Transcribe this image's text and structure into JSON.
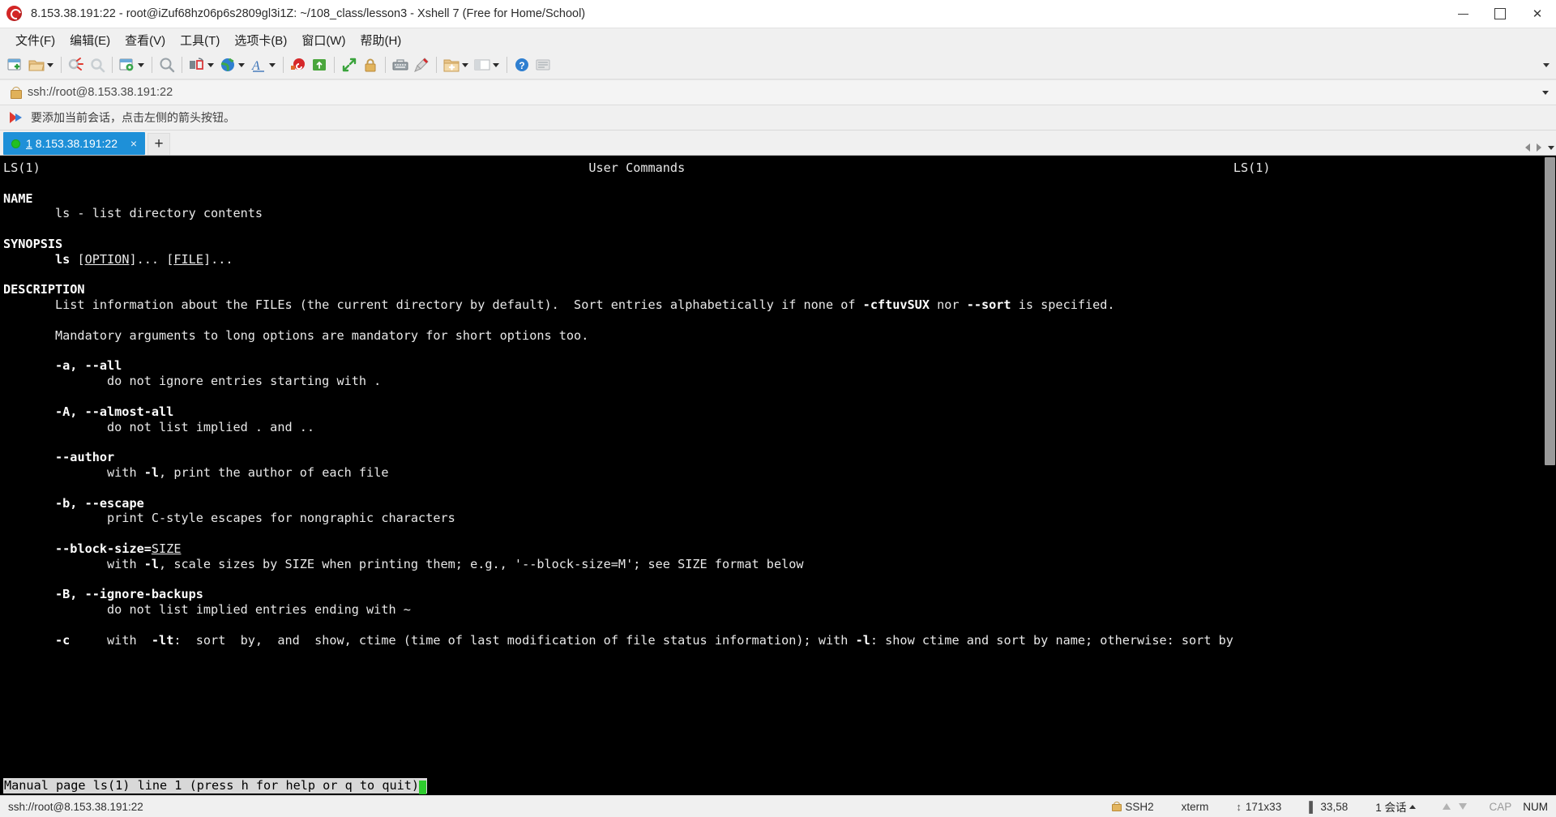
{
  "window": {
    "title": "8.153.38.191:22 - root@iZuf68hz06p6s2809gl3i1Z: ~/108_class/lesson3 - Xshell 7 (Free for Home/School)",
    "app_icon": "xshell-logo-icon",
    "minimize_label": "—",
    "maximize_label": "❐",
    "close_label": "✕"
  },
  "menu": {
    "items": [
      {
        "label": "文件(F)",
        "name": "menu-file"
      },
      {
        "label": "编辑(E)",
        "name": "menu-edit"
      },
      {
        "label": "查看(V)",
        "name": "menu-view"
      },
      {
        "label": "工具(T)",
        "name": "menu-tools"
      },
      {
        "label": "选项卡(B)",
        "name": "menu-tabs"
      },
      {
        "label": "窗口(W)",
        "name": "menu-window"
      },
      {
        "label": "帮助(H)",
        "name": "menu-help"
      }
    ]
  },
  "toolbar": {
    "overflow_label": "▾",
    "icons": [
      "new-session-icon",
      "open-session-icon",
      "disconnect-icon",
      "reconnect-icon",
      "session-properties-icon",
      "find-icon",
      "layout-icon",
      "transfer-icon",
      "globe-icon",
      "font-icon",
      "compose-icon",
      "ssh-key-icon",
      "transfer-file-icon",
      "lock-screen-icon",
      "keyboard-icon",
      "highlight-icon",
      "new-folder-icon",
      "arrange-icon",
      "help-icon",
      "notes-icon"
    ]
  },
  "address_bar": {
    "value": "ssh://root@8.153.38.191:22",
    "lock_icon": "lock-icon",
    "dropdown_icon": "chevron-down-icon"
  },
  "notice_bar": {
    "icon": "flag-icon",
    "text": "要添加当前会话，点击左侧的箭头按钮。"
  },
  "tabs": {
    "items": [
      {
        "number": "1",
        "label": "8.153.38.191:22",
        "status": "connected",
        "close_label": "×"
      }
    ],
    "add_label": "+",
    "scroll_left_icon": "chevron-left-icon",
    "scroll_right_icon": "chevron-right-icon",
    "tab_menu_icon": "chevron-down-icon"
  },
  "terminal": {
    "header": {
      "left": "LS(1)",
      "center": "User Commands",
      "right": "LS(1)"
    },
    "lines": [
      {
        "text": "LS(1)",
        "style": "plain"
      },
      {
        "text": "",
        "style": "plain"
      },
      {
        "text": "NAME",
        "style": "bold"
      },
      {
        "text": "       ls - list directory contents",
        "style": "plain"
      },
      {
        "text": "",
        "style": "plain"
      },
      {
        "text": "SYNOPSIS",
        "style": "bold"
      },
      {
        "text": "       ls [OPTION]... [FILE]...",
        "style": "synopsis"
      },
      {
        "text": "",
        "style": "plain"
      },
      {
        "text": "DESCRIPTION",
        "style": "bold"
      },
      {
        "text": "       List information about the FILEs (the current directory by default).  Sort entries alphabetically if none of -cftuvSUX nor --sort is specified.",
        "style": "desc"
      },
      {
        "text": "",
        "style": "plain"
      },
      {
        "text": "       Mandatory arguments to long options are mandatory for short options too.",
        "style": "plain"
      },
      {
        "text": "",
        "style": "plain"
      },
      {
        "text": "       -a, --all",
        "style": "opt"
      },
      {
        "text": "              do not ignore entries starting with .",
        "style": "plain"
      },
      {
        "text": "",
        "style": "plain"
      },
      {
        "text": "       -A, --almost-all",
        "style": "opt"
      },
      {
        "text": "              do not list implied . and ..",
        "style": "plain"
      },
      {
        "text": "",
        "style": "plain"
      },
      {
        "text": "       --author",
        "style": "opt"
      },
      {
        "text": "              with -l, print the author of each file",
        "style": "inline-l"
      },
      {
        "text": "",
        "style": "plain"
      },
      {
        "text": "       -b, --escape",
        "style": "opt"
      },
      {
        "text": "              print C-style escapes for nongraphic characters",
        "style": "plain"
      },
      {
        "text": "",
        "style": "plain"
      },
      {
        "text": "       --block-size=SIZE",
        "style": "opt-underline"
      },
      {
        "text": "              with -l, scale sizes by SIZE when printing them; e.g., '--block-size=M'; see SIZE format below",
        "style": "inline-l"
      },
      {
        "text": "",
        "style": "plain"
      },
      {
        "text": "       -B, --ignore-backups",
        "style": "opt"
      },
      {
        "text": "              do not list implied entries ending with ~",
        "style": "plain"
      },
      {
        "text": "",
        "style": "plain"
      },
      {
        "text": "       -c     with  -lt:  sort  by,  and  show, ctime (time of last modification of file status information); with -l: show ctime and sort by name; otherwise: sort by",
        "style": "opt-c"
      }
    ],
    "status_prompt": "Manual page ls(1) line 1 (press h for help or q to quit)",
    "cursor": "block-cursor"
  },
  "status_bar": {
    "connection": "ssh://root@8.153.38.191:22",
    "protocol": "SSH2",
    "protocol_icon": "lock-icon",
    "terminal_type": "xterm",
    "size": "171x33",
    "size_icon": "resize-icon",
    "cursor_position": "33,58",
    "cursor_icon": "position-icon",
    "sessions": "1 会话",
    "sessions_caret": "▲",
    "upload_icon": "arrow-up-icon",
    "download_icon": "arrow-down-icon",
    "caps_lock": "CAP",
    "num_lock": "NUM"
  },
  "colors": {
    "accent": "#1e90d8",
    "terminal_bg": "#000000",
    "terminal_fg": "#e8e8e8",
    "cursor": "#2ecc2e",
    "chrome_bg": "#f0f0f0",
    "status_inverse_bg": "#d8d8d8"
  }
}
